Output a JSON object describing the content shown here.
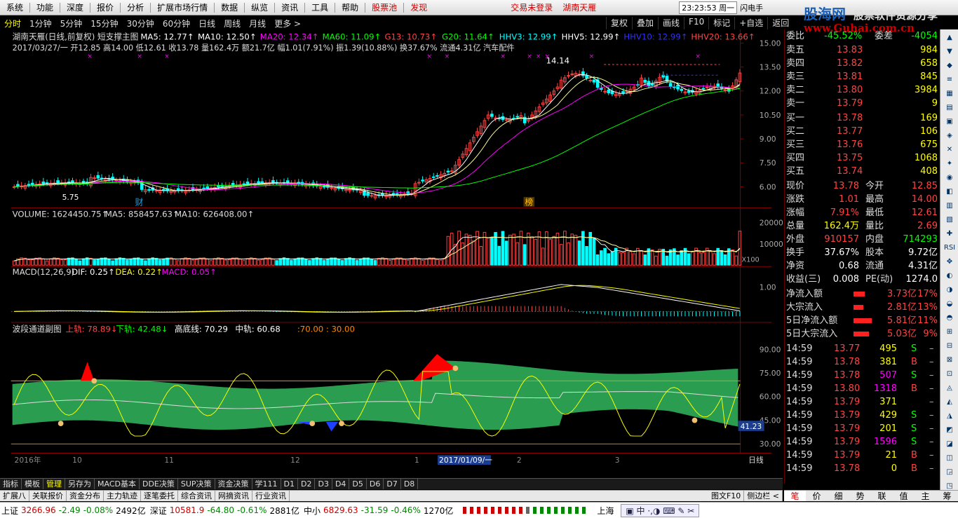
{
  "menu": [
    "系统",
    "功能",
    "深度",
    "报价",
    "分析",
    "扩展市场行情",
    "数据",
    "纵览",
    "资讯",
    "工具",
    "帮助",
    "股票池",
    "发现"
  ],
  "menu_status": {
    "login": "交易未登录",
    "stock": "湖南天雁",
    "clock": "23:23:53 周一",
    "flash": "闪电手"
  },
  "brand": {
    "cn": "股海网",
    "en": "www.Guhai.com.cn",
    "slogan": "股票软件资源分享"
  },
  "period_tabs": [
    "分时",
    "1分钟",
    "5分钟",
    "15分钟",
    "30分钟",
    "60分钟",
    "日线",
    "周线",
    "月线",
    "更多 >"
  ],
  "toolbar": [
    "复权",
    "叠加",
    "画线",
    "F10",
    "标记",
    "+自选",
    "返回"
  ],
  "main_chart": {
    "header": "湖南天雁(日线,前复权) 短支撑主图",
    "ma": [
      {
        "n": "MA5: 12.77",
        "c": "#ffffff"
      },
      {
        "n": "MA10: 12.50",
        "c": "#ffffff"
      },
      {
        "n": "MA20: 12.34",
        "c": "#ff00ff"
      },
      {
        "n": "MA60: 11.09",
        "c": "#00ff00"
      },
      {
        "n": "G13: 10.73",
        "c": "#ff4444"
      },
      {
        "n": "G20: 11.64",
        "c": "#00ff00"
      },
      {
        "n": "HHV3: 12.99",
        "c": "#00ffff"
      },
      {
        "n": "HHV5: 12.99",
        "c": "#ffffff"
      },
      {
        "n": "HHV10: 12.99",
        "c": "#3030ff"
      },
      {
        "n": "HHV20: 13.66",
        "c": "#ff4444"
      }
    ],
    "info": "2017/03/27/一 开12.85 高14.00 低12.61 收13.78 量162.4万 额21.7亿 幅1.01(7.91%) 振1.39(10.88%) 换37.67% 流通4.31亿 汽车配件",
    "high_label": "14.14",
    "low_label": "5.75",
    "marks": [
      "财",
      "榜"
    ],
    "y_ticks": [
      "15.00",
      "13.50",
      "12.00",
      "10.50",
      "9.00",
      "7.50",
      "6.00"
    ]
  },
  "volume": {
    "header": "VOLUME: 1624450.75",
    "ma5": "MA5: 858457.63",
    "ma10": "MA10: 626408.00",
    "y_ticks": [
      "20000",
      "10000"
    ],
    "unit": "X100"
  },
  "macd": {
    "header": "MACD(12,26,9)",
    "dif": "DIF: 0.25",
    "dea": "DEA: 0.22",
    "macd": "MACD: 0.05",
    "y_ticks": [
      "1.00"
    ]
  },
  "wave": {
    "title": "波段通道副图",
    "upper": "上轨: 78.89",
    "lower": "下轨: 42.48",
    "high": "高底线: 70.29",
    "mid": "中轨: 60.68",
    "levels": ":70.00 : 30.00",
    "y_ticks": [
      "90.00",
      "75.00",
      "60.00",
      "45.00",
      "30.00"
    ],
    "cursor_value": "41.23"
  },
  "x_axis": {
    "labels": [
      "2016年",
      "10",
      "11",
      "12",
      "1",
      "2",
      "3"
    ],
    "cursor_date": "2017/01/09/一",
    "period": "日线"
  },
  "order_book": {
    "wei_bi": "委比",
    "wei_bi_pct": "-45.52%",
    "wei_cha": "委差",
    "wei_cha_val": "-4054",
    "asks": [
      {
        "l": "卖五",
        "p": "13.83",
        "v": "984"
      },
      {
        "l": "卖四",
        "p": "13.82",
        "v": "658"
      },
      {
        "l": "卖三",
        "p": "13.81",
        "v": "845"
      },
      {
        "l": "卖二",
        "p": "13.80",
        "v": "3984"
      },
      {
        "l": "卖一",
        "p": "13.79",
        "v": "9"
      }
    ],
    "bids": [
      {
        "l": "买一",
        "p": "13.78",
        "v": "169"
      },
      {
        "l": "买二",
        "p": "13.77",
        "v": "106"
      },
      {
        "l": "买三",
        "p": "13.76",
        "v": "675"
      },
      {
        "l": "买四",
        "p": "13.75",
        "v": "1068"
      },
      {
        "l": "买五",
        "p": "13.74",
        "v": "408"
      }
    ]
  },
  "quote": [
    {
      "a": "现价",
      "av": "13.78",
      "b": "今开",
      "bv": "12.85",
      "ac": "#ff4444",
      "bc": "#ff4444"
    },
    {
      "a": "涨跌",
      "av": "1.01",
      "b": "最高",
      "bv": "14.00",
      "ac": "#ff4444",
      "bc": "#ff4444"
    },
    {
      "a": "涨幅",
      "av": "7.91%",
      "b": "最低",
      "bv": "12.61",
      "ac": "#ff4444",
      "bc": "#ff4444"
    },
    {
      "a": "总量",
      "av": "162.4万",
      "b": "量比",
      "bv": "2.69",
      "ac": "#ffff00",
      "bc": "#ff4444"
    },
    {
      "a": "外盘",
      "av": "910157",
      "b": "内盘",
      "bv": "714293",
      "ac": "#ff4444",
      "bc": "#00ff00"
    },
    {
      "a": "换手",
      "av": "37.67%",
      "b": "股本",
      "bv": "9.72亿",
      "ac": "#ffffff",
      "bc": "#ffffff"
    },
    {
      "a": "净资",
      "av": "0.68",
      "b": "流通",
      "bv": "4.31亿",
      "ac": "#ffffff",
      "bc": "#ffffff"
    },
    {
      "a": "收益(三)",
      "av": "0.008",
      "b": "PE(动)",
      "bv": "1274.0",
      "ac": "#ffffff",
      "bc": "#ffffff"
    }
  ],
  "flows": [
    {
      "l": "净流入额",
      "v": "3.73亿",
      "p": "17%"
    },
    {
      "l": "大宗流入",
      "v": "2.81亿",
      "p": "13%"
    },
    {
      "l": "5日净流入额",
      "v": "5.81亿",
      "p": "11%"
    },
    {
      "l": "5日大宗流入",
      "v": "5.03亿",
      "p": "9%"
    }
  ],
  "ticks": [
    {
      "t": "14:59",
      "p": "13.77",
      "v": "495",
      "s": "S"
    },
    {
      "t": "14:59",
      "p": "13.78",
      "v": "381",
      "s": "B"
    },
    {
      "t": "14:59",
      "p": "13.78",
      "v": "507",
      "s": "S"
    },
    {
      "t": "14:59",
      "p": "13.80",
      "v": "1318",
      "s": "B"
    },
    {
      "t": "14:59",
      "p": "13.79",
      "v": "371",
      "s": ""
    },
    {
      "t": "14:59",
      "p": "13.79",
      "v": "429",
      "s": "S"
    },
    {
      "t": "14:59",
      "p": "13.79",
      "v": "201",
      "s": "S"
    },
    {
      "t": "14:59",
      "p": "13.79",
      "v": "1596",
      "s": "S"
    },
    {
      "t": "14:59",
      "p": "13.79",
      "v": "21",
      "s": "B"
    },
    {
      "t": "14:59",
      "p": "13.78",
      "v": "0",
      "s": "B"
    }
  ],
  "bottom_tabs1": [
    "指标",
    "模板",
    "管理",
    "另存为",
    "MACD基本",
    "DDE决策",
    "SUP决策",
    "资金决策",
    "学111",
    "D1",
    "D2",
    "D3",
    "D4",
    "D5",
    "D6",
    "D7",
    "D8"
  ],
  "bottom_tabs2": [
    "扩展八",
    "关联报价",
    "资金分布",
    "主力轨迹",
    "逐笔委托",
    "综合资讯",
    "网摘资讯",
    "行业资讯"
  ],
  "bottom_right": [
    "图文F10",
    "侧边栏 <"
  ],
  "right_tabs": [
    "笔",
    "价",
    "细",
    "势",
    "联",
    "值",
    "主",
    "筹"
  ],
  "status": {
    "sh": "上证",
    "sh_v": "3266.96",
    "sh_c": "-2.49",
    "sh_p": "-0.08%",
    "sh_a": "2492亿",
    "sz": "深证",
    "sz_v": "10581.9",
    "sz_c": "-64.80",
    "sz_p": "-0.61%",
    "sz_a": "2881亿",
    "zx": "中小",
    "zx_v": "6829.63",
    "zx_c": "-31.59",
    "zx_p": "-0.46%",
    "zx_a": "1270亿",
    "sh2": "上海"
  },
  "colors": {
    "up": "#ff4444",
    "down": "#00ffff",
    "yellow": "#ffff00",
    "green": "#00ff00",
    "channel": "#2a9d50"
  }
}
